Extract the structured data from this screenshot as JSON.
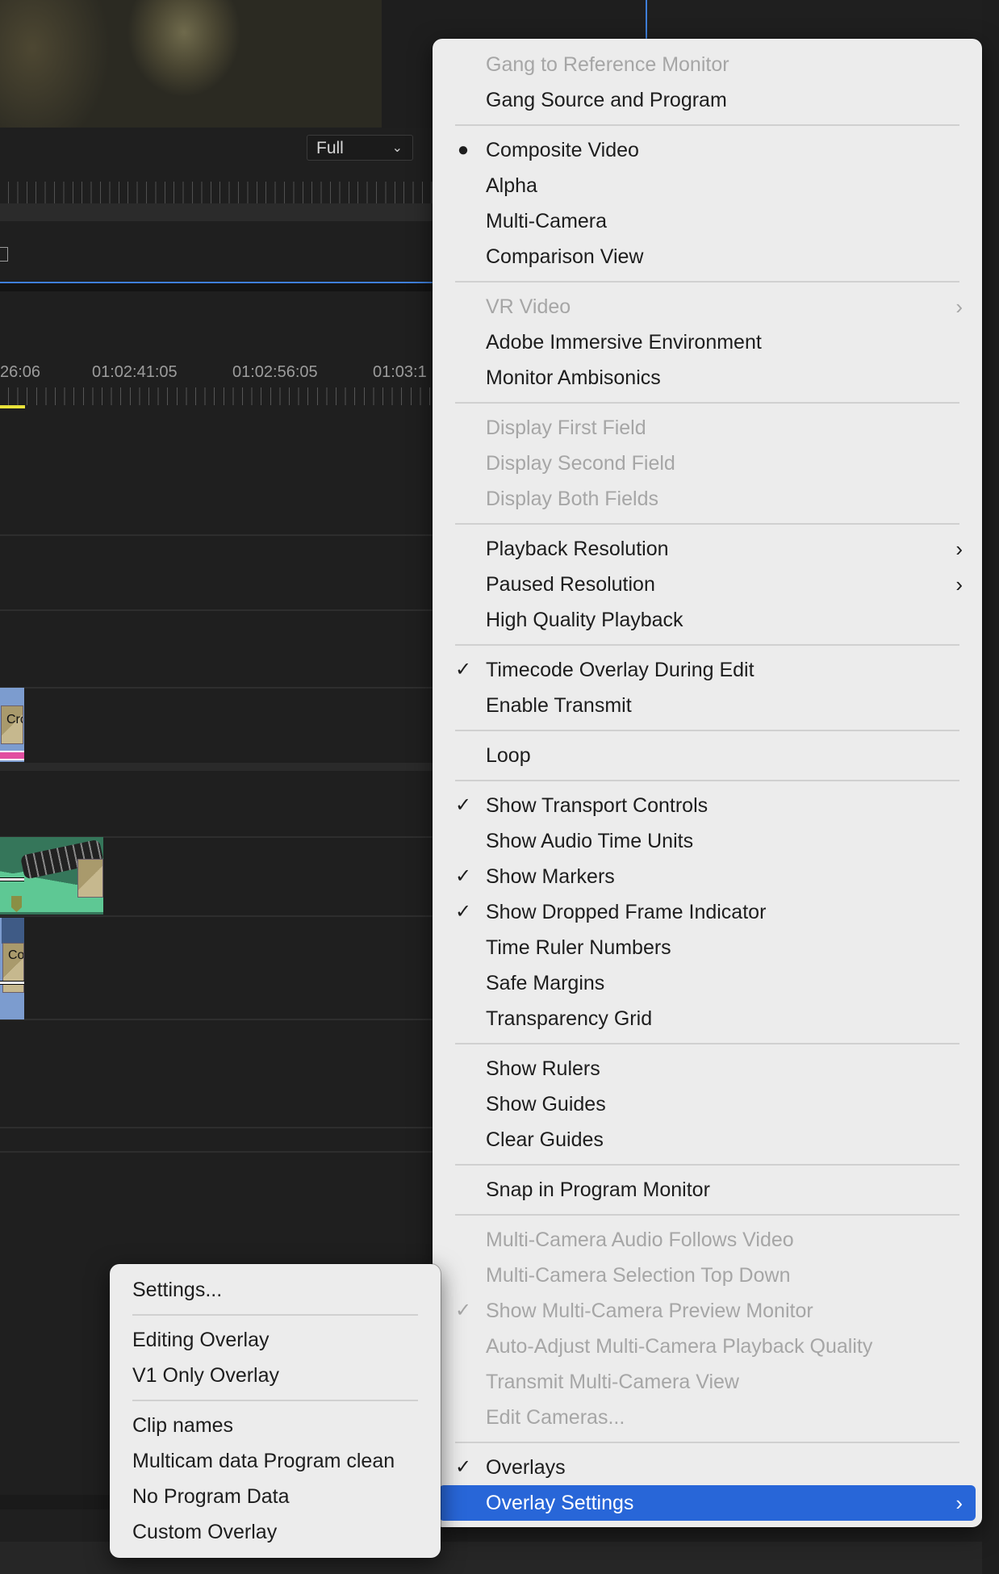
{
  "program_monitor": {
    "playback_resolution_select": "Full",
    "select_icon": "chevron-down-icon"
  },
  "timeline": {
    "timecodes": [
      "26:06",
      "01:02:41:05",
      "01:02:56:05",
      "01:03:1"
    ],
    "clips": [
      {
        "label": "Cro",
        "type": "video"
      },
      {
        "label": "",
        "type": "audio"
      },
      {
        "label": "Co",
        "type": "video"
      }
    ]
  },
  "main_menu": {
    "groups": [
      [
        {
          "label": "Gang to Reference Monitor",
          "disabled": true
        },
        {
          "label": "Gang Source and Program"
        }
      ],
      [
        {
          "label": "Composite Video",
          "mark": "●"
        },
        {
          "label": "Alpha"
        },
        {
          "label": "Multi-Camera"
        },
        {
          "label": "Comparison View"
        }
      ],
      [
        {
          "label": "VR Video",
          "disabled": true,
          "submenu": true
        },
        {
          "label": "Adobe Immersive Environment"
        },
        {
          "label": "Monitor Ambisonics"
        }
      ],
      [
        {
          "label": "Display First Field",
          "disabled": true
        },
        {
          "label": "Display Second Field",
          "disabled": true
        },
        {
          "label": "Display Both Fields",
          "disabled": true
        }
      ],
      [
        {
          "label": "Playback Resolution",
          "submenu": true
        },
        {
          "label": "Paused Resolution",
          "submenu": true
        },
        {
          "label": "High Quality Playback"
        }
      ],
      [
        {
          "label": "Timecode Overlay During Edit",
          "mark": "✓"
        },
        {
          "label": "Enable Transmit"
        }
      ],
      [
        {
          "label": "Loop"
        }
      ],
      [
        {
          "label": "Show Transport Controls",
          "mark": "✓"
        },
        {
          "label": "Show Audio Time Units"
        },
        {
          "label": "Show Markers",
          "mark": "✓"
        },
        {
          "label": "Show Dropped Frame Indicator",
          "mark": "✓"
        },
        {
          "label": "Time Ruler Numbers"
        },
        {
          "label": "Safe Margins"
        },
        {
          "label": "Transparency Grid"
        }
      ],
      [
        {
          "label": "Show Rulers"
        },
        {
          "label": "Show Guides"
        },
        {
          "label": "Clear Guides"
        }
      ],
      [
        {
          "label": "Snap in Program Monitor"
        }
      ],
      [
        {
          "label": "Multi-Camera Audio Follows Video",
          "disabled": true
        },
        {
          "label": "Multi-Camera Selection Top Down",
          "disabled": true
        },
        {
          "label": "Show Multi-Camera Preview Monitor",
          "disabled": true,
          "mark": "✓"
        },
        {
          "label": "Auto-Adjust Multi-Camera Playback Quality",
          "disabled": true
        },
        {
          "label": "Transmit Multi-Camera View",
          "disabled": true
        },
        {
          "label": "Edit Cameras...",
          "disabled": true
        }
      ],
      [
        {
          "label": "Overlays",
          "mark": "✓"
        },
        {
          "label": "Overlay Settings",
          "submenu": true,
          "highlighted": true
        }
      ]
    ]
  },
  "overlay_submenu": {
    "groups": [
      [
        {
          "label": "Settings..."
        }
      ],
      [
        {
          "label": "Editing Overlay"
        },
        {
          "label": "V1 Only Overlay"
        }
      ],
      [
        {
          "label": "Clip names"
        },
        {
          "label": "Multicam data Program clean"
        },
        {
          "label": "No Program Data"
        },
        {
          "label": "Custom Overlay"
        }
      ]
    ]
  },
  "colors": {
    "menu_background": "#ececec",
    "highlight": "#2866d8",
    "disabled_text": "#a6a6a6",
    "app_background": "#1f1f1f",
    "timeline_blue": "#3f7fd9",
    "playhead_yellow": "#e8e23a"
  }
}
